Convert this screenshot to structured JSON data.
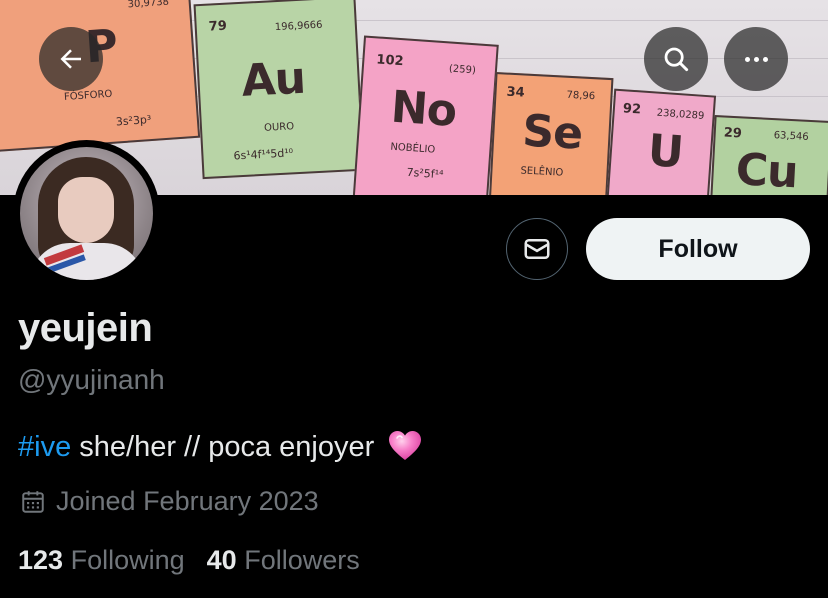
{
  "banner": {
    "tiles": [
      {
        "number": "",
        "mass": "30,9738",
        "symbol": "P",
        "name": "FÓSFORO",
        "config": "3s²3p³",
        "color": "#f0a07c"
      },
      {
        "number": "79",
        "mass": "196,9666",
        "symbol": "Au",
        "name": "OURO",
        "config": "6s¹4f¹⁴5d¹⁰",
        "color": "#b8d4a6"
      },
      {
        "number": "102",
        "mass": "(259)",
        "symbol": "No",
        "name": "NOBÉLIO",
        "config": "7s²5f¹⁴",
        "color": "#f4a3c6"
      },
      {
        "number": "34",
        "mass": "78,96",
        "symbol": "Se",
        "name": "SELÊNIO",
        "config": "",
        "color": "#f3a276"
      },
      {
        "number": "92",
        "mass": "238,0289",
        "symbol": "U",
        "name": "",
        "config": "",
        "color": "#f0a9c9"
      },
      {
        "number": "29",
        "mass": "63,546",
        "symbol": "Cu",
        "name": "",
        "config": "",
        "color": "#b2d1a0"
      }
    ]
  },
  "nav": {
    "back_icon": "arrow-left-icon",
    "search_icon": "search-icon",
    "more_icon": "more-horizontal-icon"
  },
  "actions": {
    "message_icon": "envelope-icon",
    "follow_label": "Follow"
  },
  "profile": {
    "display_name": "yeujein",
    "handle": "@yyujinanh",
    "bio_hashtag": "#ive",
    "bio_text": " she/her // poca enjoyer",
    "bio_emoji": "pink-heart-icon",
    "joined_text": "Joined February 2023"
  },
  "stats": {
    "following_count": "123",
    "following_label": "Following",
    "followers_count": "40",
    "followers_label": "Followers"
  },
  "colors": {
    "background": "#000000",
    "primary_text": "#e7e9ea",
    "secondary_text": "#71767b",
    "link": "#1d9bf0",
    "follow_button": "#eff3f4"
  }
}
